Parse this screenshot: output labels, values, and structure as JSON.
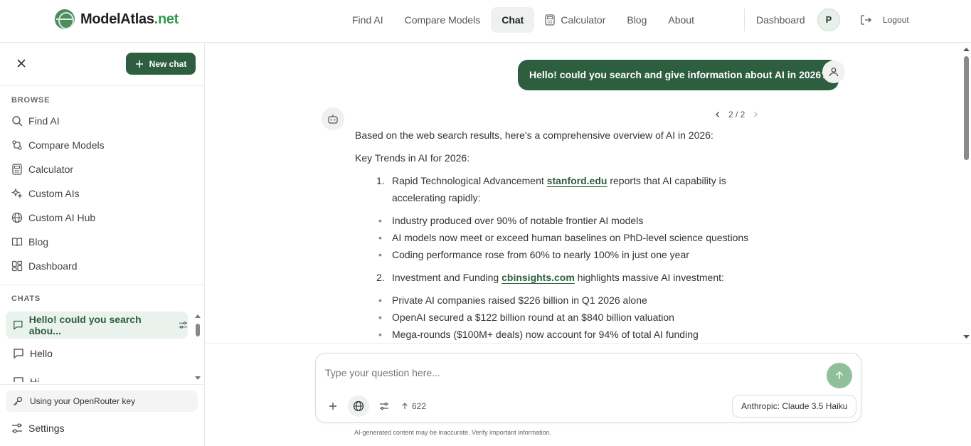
{
  "brand": {
    "name_main": "ModelAtlas",
    "name_suffix": ".net"
  },
  "nav": {
    "items": [
      {
        "label": "Find AI"
      },
      {
        "label": "Compare Models"
      },
      {
        "label": "Chat"
      },
      {
        "label": "Calculator"
      },
      {
        "label": "Blog"
      },
      {
        "label": "About"
      }
    ],
    "active": "Chat",
    "dashboard": "Dashboard",
    "avatar_initial": "P",
    "logout": "Logout"
  },
  "sidebar": {
    "new_chat": "New chat",
    "browse_label": "BROWSE",
    "browse_items": [
      {
        "label": "Find AI",
        "icon": "search-icon"
      },
      {
        "label": "Compare Models",
        "icon": "compare-icon"
      },
      {
        "label": "Calculator",
        "icon": "calculator-icon"
      },
      {
        "label": "Custom AIs",
        "icon": "sparkles-icon"
      },
      {
        "label": "Custom AI Hub",
        "icon": "globe-icon"
      },
      {
        "label": "Blog",
        "icon": "book-icon"
      },
      {
        "label": "Dashboard",
        "icon": "dashboard-icon"
      }
    ],
    "chats_label": "CHATS",
    "chats": [
      {
        "label": "Hello! could you search abou..."
      },
      {
        "label": "Hello"
      },
      {
        "label": "Hi"
      }
    ],
    "key_status": "Using your OpenRouter key",
    "settings": "Settings"
  },
  "conversation": {
    "user_message": "Hello! could you search and give information about AI in 2026?",
    "pager": "2 / 2",
    "intro": "Based on the web search results, here's a comprehensive overview of AI in 2026:",
    "heading": "Key Trends in AI for 2026:",
    "sections": [
      {
        "num": "1.",
        "title": "Rapid Technological Advancement",
        "link": "stanford.edu",
        "rest": "reports that AI capability is accelerating rapidly:",
        "bullets": [
          "Industry produced over 90% of notable frontier AI models",
          "AI models now meet or exceed human baselines on PhD-level science questions",
          "Coding performance rose from 60% to nearly 100% in just one year"
        ]
      },
      {
        "num": "2.",
        "title": "Investment and Funding",
        "link": "cbinsights.com",
        "rest": "highlights massive AI investment:",
        "bullets": [
          "Private AI companies raised $226 billion in Q1 2026 alone",
          "OpenAI secured a $122 billion round at an $840 billion valuation",
          "Mega-rounds ($100M+ deals) now account for 94% of total AI funding"
        ]
      }
    ]
  },
  "composer": {
    "placeholder": "Type your question here...",
    "token_count": "622",
    "model": "Anthropic: Claude 3.5 Haiku",
    "disclaimer": "AI-generated content may be inaccurate. Verify important information."
  },
  "colors": {
    "brand_green": "#2c5e3f",
    "accent": "#2f9a4c"
  }
}
